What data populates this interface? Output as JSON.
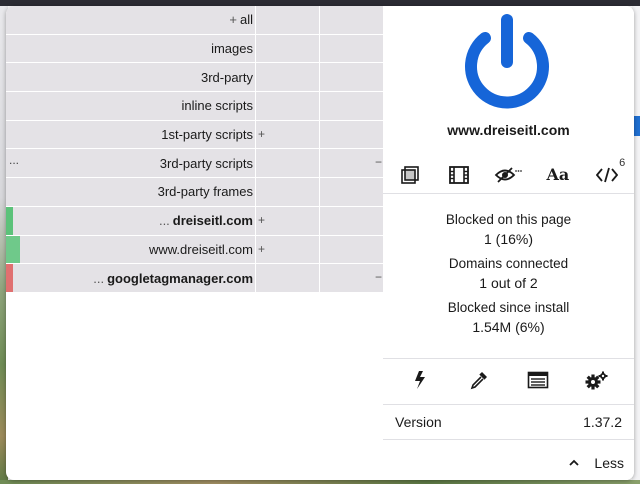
{
  "firewall": {
    "rows": [
      {
        "prefix": "+",
        "label": "all",
        "bold": false,
        "left_dots": "",
        "bar_color": "",
        "col2_symbol": "",
        "col3_symbol": ""
      },
      {
        "prefix": "",
        "label": "images",
        "bold": false,
        "left_dots": "",
        "bar_color": "",
        "col2_symbol": "",
        "col3_symbol": ""
      },
      {
        "prefix": "",
        "label": "3rd-party",
        "bold": false,
        "left_dots": "",
        "bar_color": "",
        "col2_symbol": "",
        "col3_symbol": ""
      },
      {
        "prefix": "",
        "label": "inline scripts",
        "bold": false,
        "left_dots": "",
        "bar_color": "",
        "col2_symbol": "",
        "col3_symbol": ""
      },
      {
        "prefix": "",
        "label": "1st-party scripts",
        "bold": false,
        "left_dots": "",
        "bar_color": "",
        "col2_symbol": "+",
        "col3_symbol": ""
      },
      {
        "prefix": "",
        "label": "3rd-party scripts",
        "bold": false,
        "left_dots": "...",
        "bar_color": "",
        "col2_symbol": "",
        "col3_symbol": "−"
      },
      {
        "prefix": "",
        "label": "3rd-party frames",
        "bold": false,
        "left_dots": "",
        "bar_color": "",
        "col2_symbol": "",
        "col3_symbol": ""
      },
      {
        "prefix": "...",
        "label": "dreiseitl.com",
        "bold": true,
        "left_dots": "",
        "bar_color": "#5cc27a",
        "col2_symbol": "+",
        "col3_symbol": ""
      },
      {
        "prefix": "",
        "label": "www.dreiseitl.com",
        "bold": false,
        "left_dots": "",
        "bar_color": "#6fc98a",
        "col2_symbol": "+",
        "col3_symbol": ""
      },
      {
        "prefix": "...",
        "label": "googletagmanager.com",
        "bold": true,
        "left_dots": "",
        "bar_color": "#e07070",
        "col2_symbol": "",
        "col3_symbol": "−"
      }
    ]
  },
  "panel": {
    "power_color": "#1665d8",
    "hostname": "www.dreiseitl.com",
    "tools": [
      {
        "name": "element-picker-icon"
      },
      {
        "name": "media-icon"
      },
      {
        "name": "cosmetic-filter-icon"
      },
      {
        "name": "font-icon",
        "text": "Aa"
      },
      {
        "name": "scripts-icon",
        "badge": "6"
      }
    ],
    "stats": [
      {
        "label": "Blocked on this page",
        "value": "1 (16%)"
      },
      {
        "label": "Domains connected",
        "value": "1 out of 2"
      },
      {
        "label": "Blocked since install",
        "value": "1.54M (6%)"
      }
    ],
    "bottom_tools": [
      {
        "name": "lightning-icon"
      },
      {
        "name": "eyedropper-icon"
      },
      {
        "name": "logger-icon"
      },
      {
        "name": "settings-icon"
      }
    ],
    "version_label": "Version",
    "version_value": "1.37.2",
    "less_label": "Less"
  }
}
